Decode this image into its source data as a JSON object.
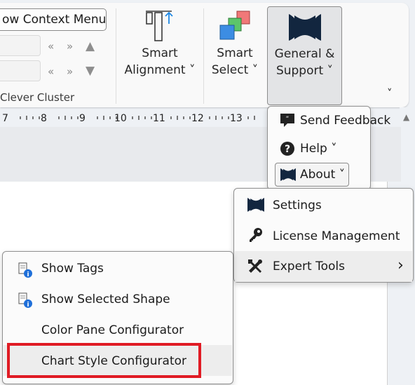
{
  "ribbon": {
    "context_menu_button": "ow Context Menu",
    "nav_prev": "«",
    "nav_next": "»",
    "arrow_up": "▲",
    "arrow_down": "▼",
    "group_label": "Clever Cluster",
    "smart_alignment": {
      "line1": "Smart",
      "line2": "Alignment",
      "chevron": "˅"
    },
    "smart_select": {
      "line1": "Smart",
      "line2": "Select",
      "chevron": "˅"
    },
    "general_support": {
      "line1": "General &",
      "line2": "Support",
      "chevron": "˅"
    },
    "collapse_chevron": "˅"
  },
  "ruler": {
    "numbers": [
      "7",
      "8",
      "9",
      "10",
      "11",
      "12",
      "13"
    ]
  },
  "support_menu": {
    "send_feedback": "Send Feedback",
    "help": "Help",
    "help_chevron": "˅",
    "about": "About",
    "about_chevron": "˅"
  },
  "about_menu": {
    "settings": "Settings",
    "license": "License Management",
    "expert_tools": "Expert Tools",
    "submenu_chevron": "›"
  },
  "expert_menu": {
    "show_tags": "Show Tags",
    "show_selected_shape": "Show Selected Shape",
    "color_pane": "Color Pane Configurator",
    "chart_style": "Chart Style Configurator"
  },
  "colors": {
    "brand_navy": "#12263f",
    "highlight_red": "#e01b24"
  }
}
